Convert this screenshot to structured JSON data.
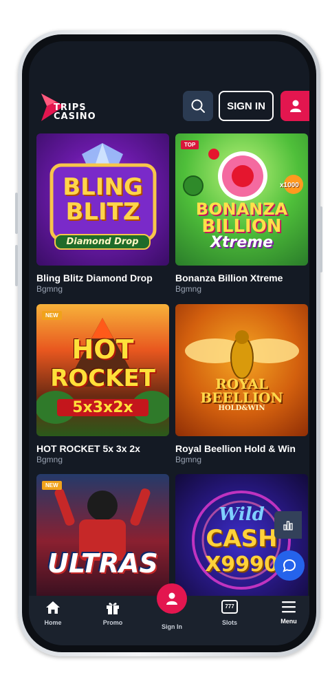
{
  "brand": {
    "logo_text_line1": "TRIPS",
    "logo_text_line2": "CASINO",
    "accent": "#e3164f"
  },
  "header": {
    "signin_label": "SIGN IN"
  },
  "games": [
    {
      "title": "Bling Blitz Diamond Drop",
      "provider": "Bgmng",
      "tag": "",
      "art_line1": "BLING",
      "art_line2": "BLITZ",
      "art_line3": "Diamond Drop"
    },
    {
      "title": "Bonanza Billion Xtreme",
      "provider": "Bgmng",
      "tag": "TOP",
      "art_line1": "BONANZA",
      "art_line2": "BILLION",
      "art_line3": "Xtreme",
      "art_badge": "x1000"
    },
    {
      "title": "HOT ROCKET 5x 3x 2x",
      "provider": "Bgmng",
      "tag": "NEW",
      "art_line1": "HOT",
      "art_line2": "ROCKET",
      "art_line3": "5x3x2x"
    },
    {
      "title": "Royal Beellion Hold & Win",
      "provider": "Bgmng",
      "tag": "",
      "art_line1": "ROYAL",
      "art_line2": "BEELLION",
      "art_line3": "HOLD&WIN"
    },
    {
      "title": "",
      "provider": "",
      "tag": "NEW",
      "art_line1": "ULTRAS"
    },
    {
      "title": "",
      "provider": "",
      "tag": "",
      "art_line1": "Wild",
      "art_line2": "CASH",
      "art_line3": "X9990"
    }
  ],
  "bottom_nav": {
    "home": "Home",
    "promo": "Promo",
    "signin": "Sign In",
    "slots": "Slots",
    "slots_icon_text": "777",
    "menu": "Menu"
  },
  "icons": [
    "search-icon",
    "user-icon",
    "bar-chart-icon",
    "chat-icon",
    "home-icon",
    "gift-icon",
    "slots-icon",
    "menu-icon"
  ]
}
